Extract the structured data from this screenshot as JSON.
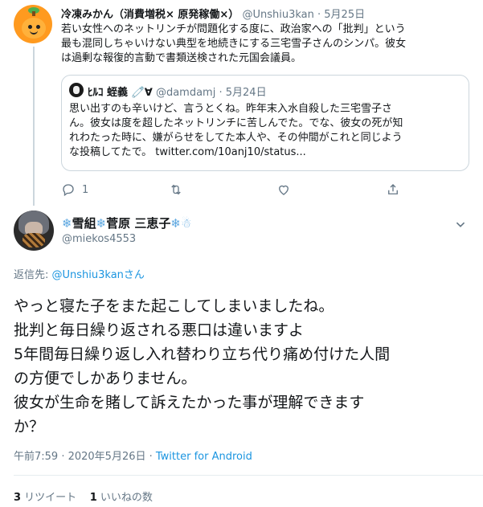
{
  "parent_tweet": {
    "name": "冷凍みかん（消費増税× 原発稼働×）",
    "handle": "@Unshiu3kan",
    "separator": "·",
    "date": "5月25日",
    "text_lines": [
      "若い女性へのネットリンチが問題化する度に、政治家への「批判」という",
      "最も混同しちゃいけない典型を地続きにする三宅雪子さんのシンパ。彼女",
      "は過剰な報復的言動で書類送検された元国会議員。"
    ],
    "quote": {
      "name": "ﾋﾙｺ 蛭義 🧷∀",
      "handle": "@damdamj",
      "separator": "·",
      "date": "5月24日",
      "text_lines": [
        "思い出すのも辛いけど、言うとくね。昨年末入水自殺した三宅雪子さ",
        "ん。彼女は度を超したネットリンチに苦しんでた。でな、彼女の死が知",
        "れわたった時に、嫌がらせをしてた本人や、その仲間がこれと同じよう",
        "な投稿してたで。 twitter.com/10anj10/status..."
      ]
    },
    "actions": {
      "reply_count": "1",
      "retweet_count": "",
      "like_count": "",
      "icons": [
        "reply-icon",
        "retweet-icon",
        "like-icon",
        "share-icon"
      ]
    }
  },
  "main_tweet": {
    "name_prefix": "❄",
    "name_part1": "雪組",
    "name_mid": "❄",
    "name_part2": "菅原 三恵子",
    "name_suffix": "❄☃",
    "handle": "@miekos4553",
    "reply_label": "返信先: ",
    "reply_to": "@Unshiu3kan",
    "reply_suffix": "さん",
    "body_lines": [
      "やっと寝た子をまた起こしてしまいましたね。",
      "批判と毎日繰り返される悪口は違いますよ",
      "5年間毎日繰り返し入れ替わり立ち代り痛め付けた人間",
      "の方便でしかありません。",
      "彼女が生命を賭して訴えたかった事が理解できます",
      "か？"
    ],
    "time": "午前7:59 · 2020年5月26日 · ",
    "source": "Twitter for Android",
    "retweets_count": "3",
    "retweets_label": " リツイート",
    "likes_count": "1",
    "likes_label": " いいねの数"
  },
  "colors": {
    "accent": "#1b95e0",
    "secondary_text": "#657786",
    "border": "#ccd6dd"
  }
}
